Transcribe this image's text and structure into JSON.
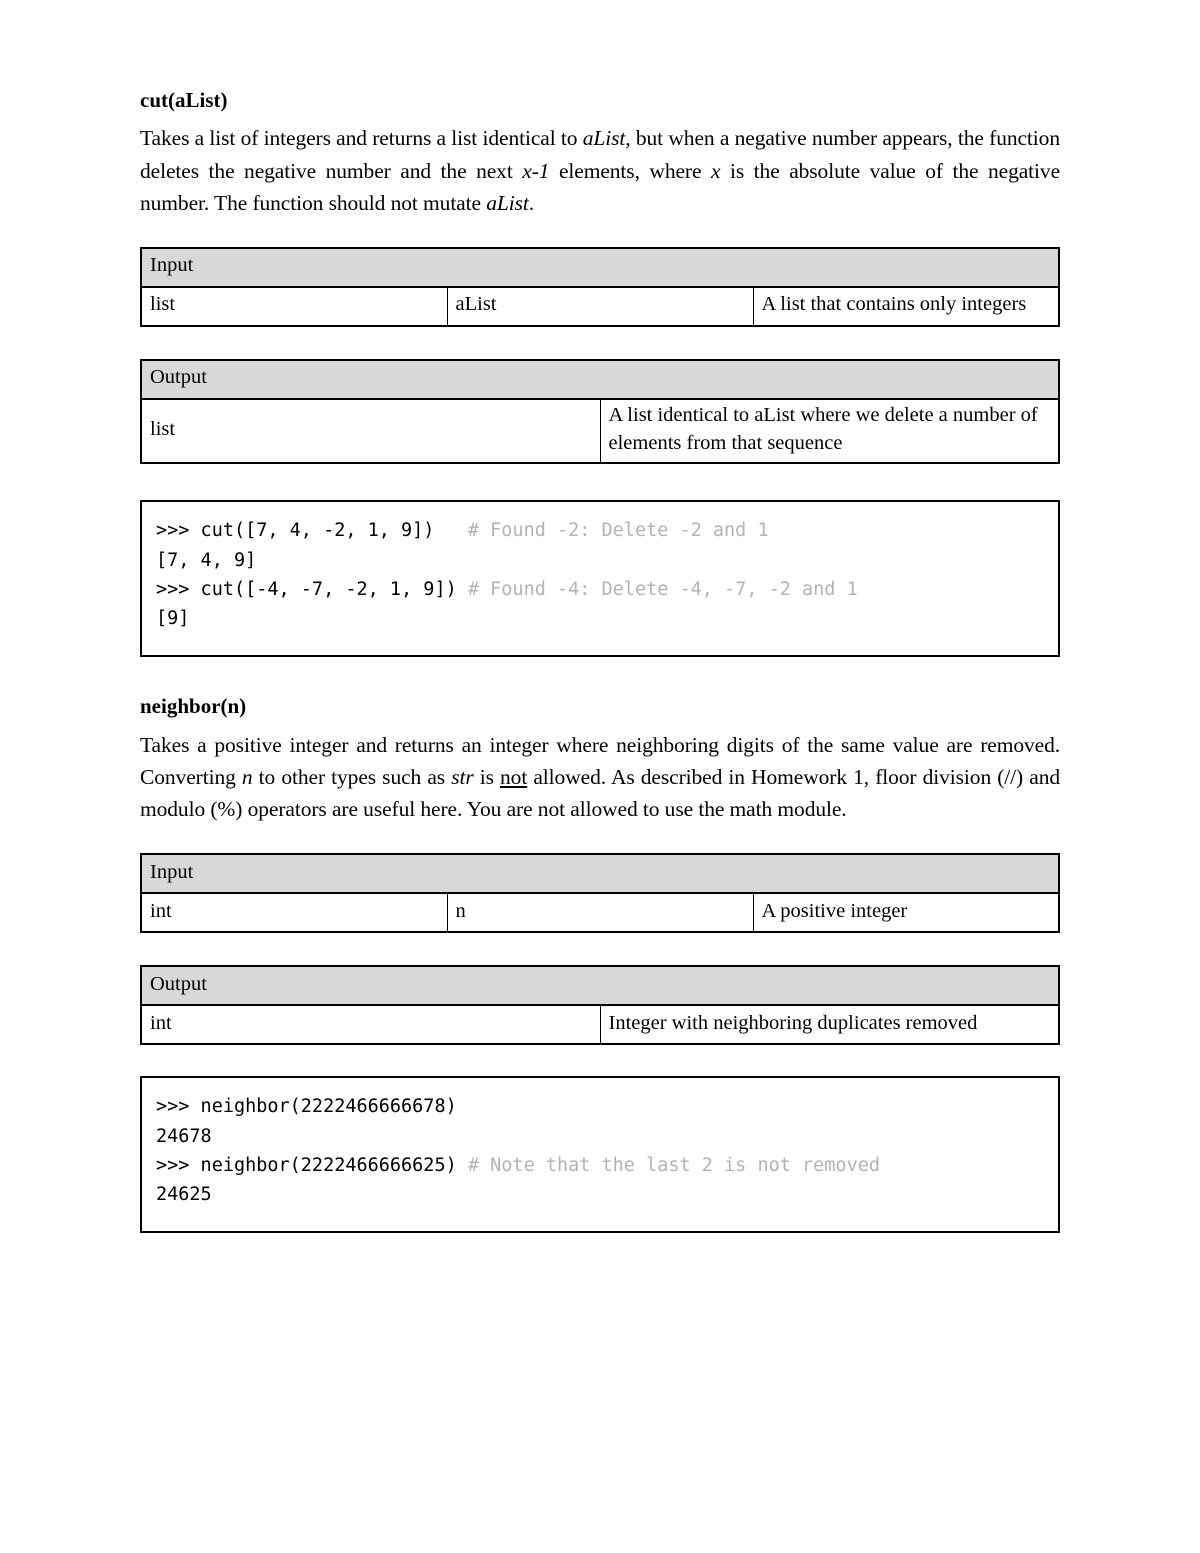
{
  "document": {
    "sections": [
      {
        "id": "cut",
        "heading": "cut(aList)",
        "description_parts": [
          {
            "t": "Takes a list of integers and returns a list identical to ",
            "style": "normal"
          },
          {
            "t": "aList",
            "style": "italic"
          },
          {
            "t": ", but when a negative number appears, the function deletes the negative number and the next ",
            "style": "normal"
          },
          {
            "t": "x-1",
            "style": "italic"
          },
          {
            "t": " elements, where ",
            "style": "normal"
          },
          {
            "t": "x",
            "style": "italic"
          },
          {
            "t": " is the absolute value of the negative number. The function should not mutate ",
            "style": "normal"
          },
          {
            "t": "aList",
            "style": "italic"
          },
          {
            "t": ".",
            "style": "normal"
          }
        ],
        "input_table": {
          "header": "Input",
          "row": {
            "type": "list",
            "name": "aList",
            "description": "A list that contains only integers"
          }
        },
        "output_table": {
          "header": "Output",
          "row": {
            "type": "list",
            "description": "A list identical to aList where we delete a number of elements from that sequence"
          }
        },
        "code_lines": [
          {
            "code": ">>> cut([7, 4, -2, 1, 9])   ",
            "comment": "# Found -2: Delete -2 and 1"
          },
          {
            "code": "[7, 4, 9]",
            "comment": ""
          },
          {
            "code": ">>> cut([-4, -7, -2, 1, 9]) ",
            "comment": "# Found -4: Delete -4, -7, -2 and 1"
          },
          {
            "code": "[9]",
            "comment": ""
          }
        ]
      },
      {
        "id": "neighbor",
        "heading": "neighbor(n)",
        "description_parts": [
          {
            "t": "Takes a positive integer and returns an integer where neighboring digits of the same value are removed. Converting ",
            "style": "normal"
          },
          {
            "t": "n",
            "style": "italic"
          },
          {
            "t": " to other types such as ",
            "style": "normal"
          },
          {
            "t": "str",
            "style": "italic"
          },
          {
            "t": " is ",
            "style": "normal"
          },
          {
            "t": "not",
            "style": "underline"
          },
          {
            "t": " allowed. As described in Homework 1, floor division (//) and modulo (%) operators are useful here. You are not allowed to use the math module.",
            "style": "normal"
          }
        ],
        "input_table": {
          "header": "Input",
          "row": {
            "type": "int",
            "name": "n",
            "description": "A positive integer"
          }
        },
        "output_table": {
          "header": "Output",
          "row": {
            "type": "int",
            "description": "Integer with neighboring duplicates removed"
          }
        },
        "code_lines": [
          {
            "code": ">>> neighbor(2222466666678)",
            "comment": ""
          },
          {
            "code": "24678",
            "comment": ""
          },
          {
            "code": ">>> neighbor(2222466666625) ",
            "comment": "# Note that the last 2 is not removed"
          },
          {
            "code": "24625",
            "comment": ""
          }
        ]
      }
    ]
  },
  "colors": {
    "table_header_bg": "#d8d8d8",
    "border": "#000000",
    "comment_text": "#b3b3b3",
    "body_text": "#000000",
    "page_bg": "#ffffff"
  }
}
